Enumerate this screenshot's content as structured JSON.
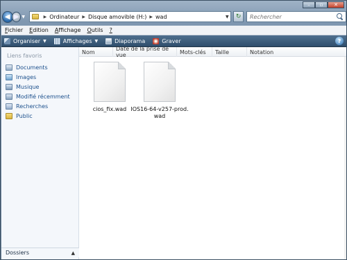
{
  "address_bar": {
    "crumbs": [
      "Ordinateur",
      "Disque amovible (H:)",
      "wad"
    ]
  },
  "search": {
    "placeholder": "Rechercher"
  },
  "menu": [
    {
      "underline": "F",
      "rest": "ichier"
    },
    {
      "underline": "E",
      "rest": "dition"
    },
    {
      "underline": "A",
      "rest": "ffichage"
    },
    {
      "underline": "O",
      "rest": "utils"
    },
    {
      "underline": "?",
      "rest": ""
    }
  ],
  "toolbar": {
    "organize": "Organiser",
    "views": "Affichages",
    "slideshow": "Diaporama",
    "burn": "Graver"
  },
  "nav_pane": {
    "heading": "Liens favoris",
    "links": [
      "Documents",
      "Images",
      "Musique",
      "Modifié récemment",
      "Recherches",
      "Public"
    ],
    "folders": "Dossiers"
  },
  "columns": [
    "Nom",
    "Date de la prise de vue",
    "Mots-clés",
    "Taille",
    "Notation"
  ],
  "files": [
    {
      "name": "cios_fix.wad"
    },
    {
      "name": "IOS16-64-v257-prod.wad"
    }
  ],
  "colors": {
    "toolbar": "#2f4e6c",
    "link": "#1b4f8c"
  }
}
